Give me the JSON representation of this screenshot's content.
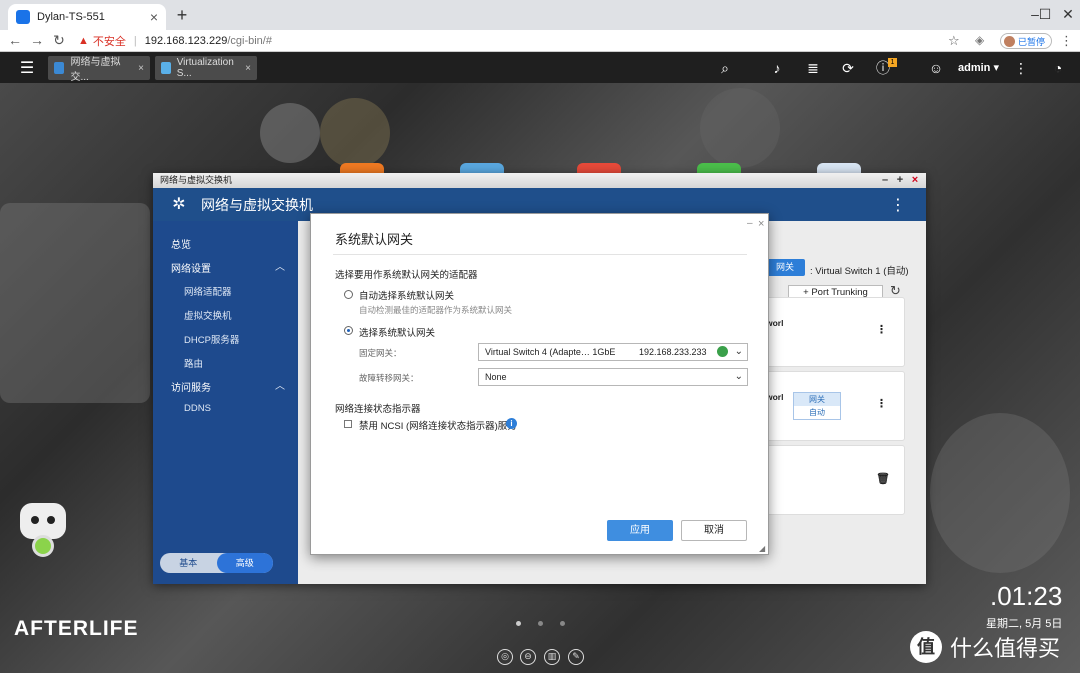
{
  "browser": {
    "tab_title": "Dylan-TS-551",
    "url_insecure": "不安全",
    "url_host": "192.168.123.229",
    "url_path": "/cgi-bin/#",
    "profile_label": "已暂停"
  },
  "qts": {
    "app_tabs": [
      "网络与虚拟交...",
      "Virtualization S..."
    ],
    "notif_count": "1",
    "user": "admin"
  },
  "window": {
    "title": "网络与虚拟交换机",
    "header_title": "网络与虚拟交换机"
  },
  "sidebar": {
    "items": [
      {
        "label": "总览"
      },
      {
        "label": "网络设置"
      },
      {
        "label": "网络适配器"
      },
      {
        "label": "虚拟交换机"
      },
      {
        "label": "DHCP服务器"
      },
      {
        "label": "路由"
      },
      {
        "label": "访问服务"
      },
      {
        "label": "DDNS"
      }
    ],
    "mode_basic": "基本",
    "mode_advanced": "高级"
  },
  "content": {
    "badge": "网关",
    "vswitch_label": ": Virtual Switch 1 (自动)",
    "port_trunking": "Port Trunking",
    "card1_text": "worl",
    "card2_text": "worl",
    "card2_badge_top": "网关",
    "card2_badge_bottom": "自动"
  },
  "dialog": {
    "title": "系统默认网关",
    "section1": "选择要用作系统默认网关的适配器",
    "opt_auto": "自动选择系统默认网关",
    "opt_auto_desc": "自动检测最佳的适配器作为系统默认网关",
    "opt_manual": "选择系统默认网关",
    "fixed_label": "固定网关：",
    "fixed_value": "Virtual Switch 4 (Adapte… 1GbE",
    "fixed_ip": "192.168.233.233",
    "failover_label": "故障转移网关：",
    "failover_value": "None",
    "section2": "网络连接状态指示器",
    "ncsi_label": "禁用 NCSI (网络连接状态指示器)服务",
    "apply": "应用",
    "cancel": "取消"
  },
  "desktop": {
    "afterlife": "AFTERLIFE",
    "clock": ".01:23",
    "date": "星期二, 5月 5日",
    "watermark": "什么值得买"
  }
}
